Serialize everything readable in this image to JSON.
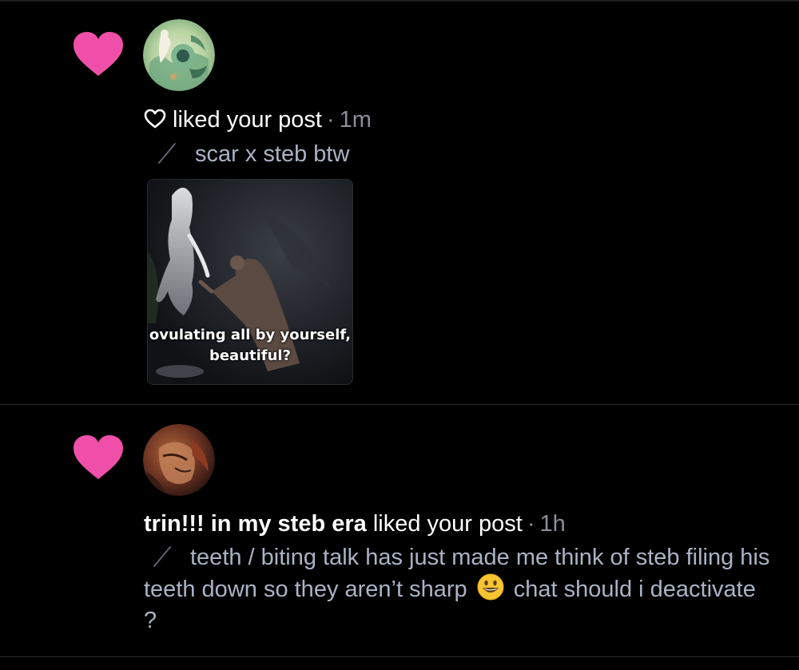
{
  "colors": {
    "background": "#000000",
    "heart_pink": "#ef4fa9",
    "muted_text": "#8b8f99",
    "quote_text": "#aab3c5",
    "divider": "#2a2b2f"
  },
  "notifications": [
    {
      "type": "like",
      "icon": "heart-icon",
      "username": "",
      "action": "liked your post",
      "time": "1m",
      "quote": "scar x steb btw",
      "image_caption_line1": "ovulating all by yourself,",
      "image_caption_line2": "beautiful?"
    },
    {
      "type": "like",
      "icon": "heart-icon",
      "username": "trin!!! in my steb era",
      "action": "liked your post",
      "time": "1h",
      "quote_part1": "teeth / biting talk has just made me think of steb filing his teeth down so they aren’t sharp",
      "quote_emoji": "smiley-emoji",
      "quote_part2": "chat should i deactivate ?"
    }
  ]
}
